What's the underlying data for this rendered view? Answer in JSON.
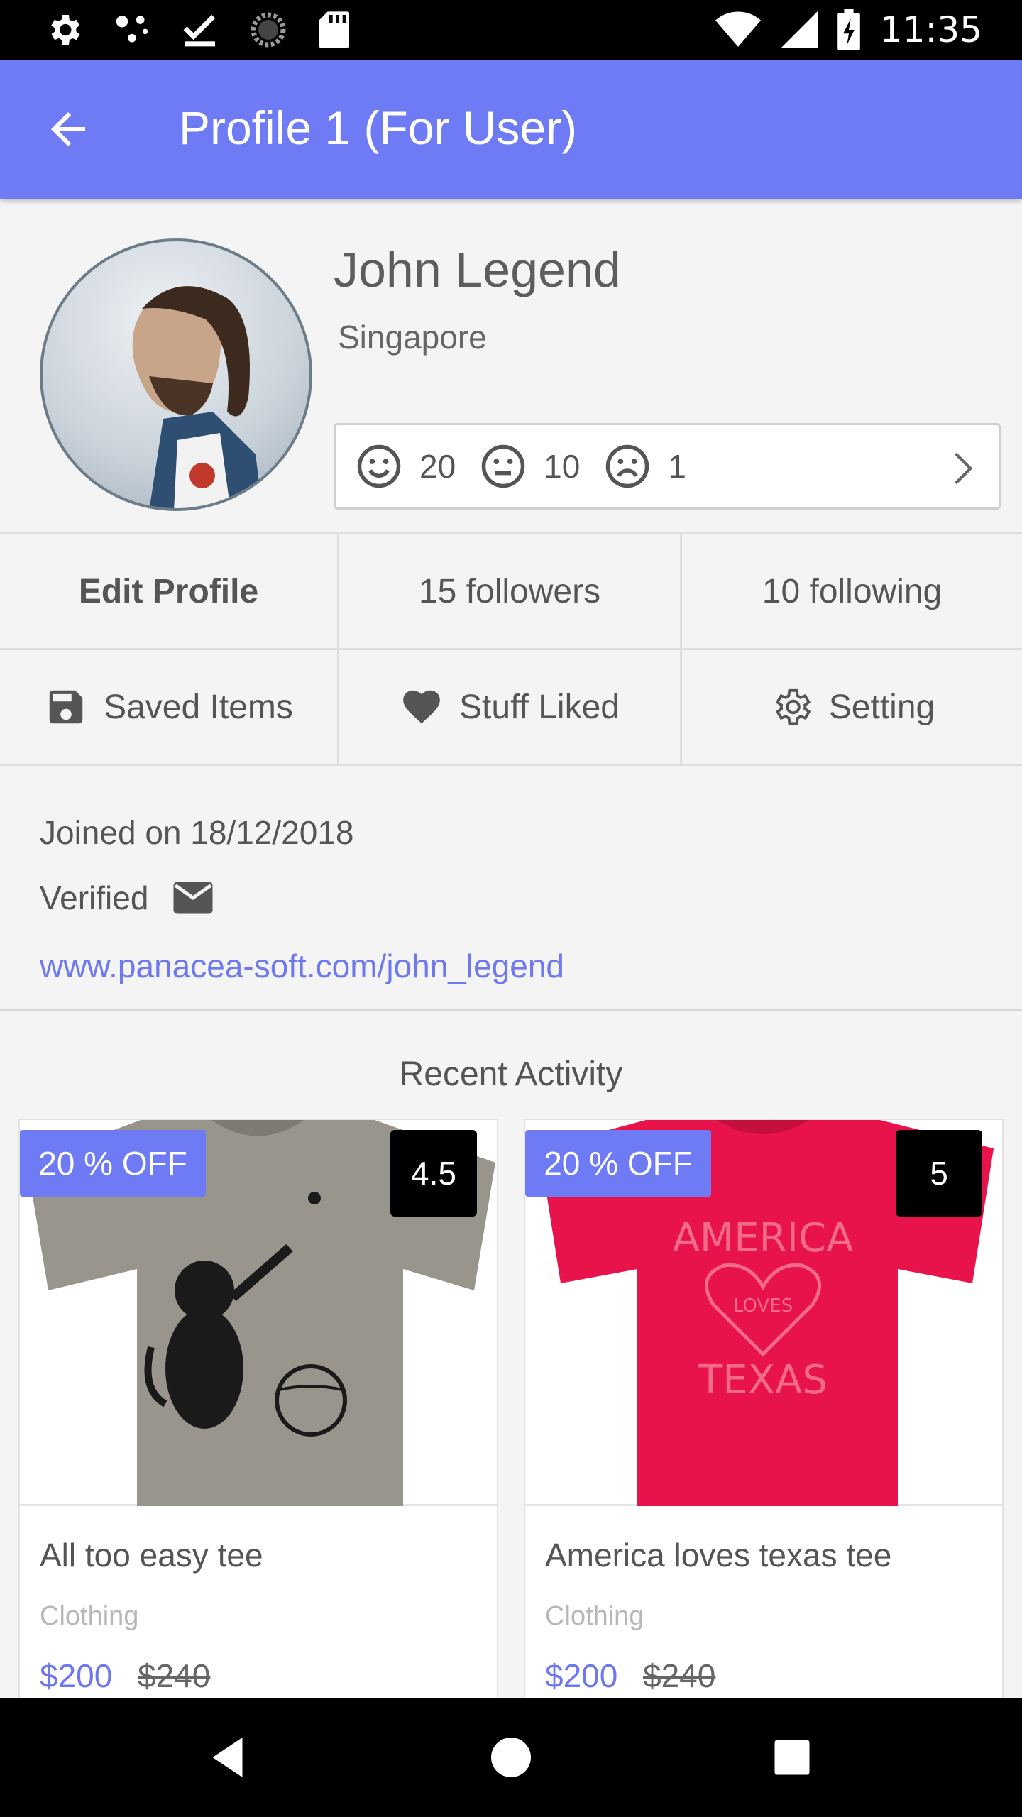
{
  "status_bar": {
    "time": "11:35",
    "left_icons": [
      "settings-icon",
      "cast-icon",
      "checkmark-icon",
      "sync-icon",
      "sd-card-icon"
    ],
    "right_icons": [
      "wifi-icon",
      "signal-icon",
      "battery-charging-icon"
    ]
  },
  "app_bar": {
    "title": "Profile 1 (For User)",
    "back_icon": "arrow-back-icon",
    "color": "#6f7bf5"
  },
  "profile": {
    "name": "John Legend",
    "location": "Singapore",
    "ratings": {
      "happy": "20",
      "neutral": "10",
      "sad": "1"
    }
  },
  "actions": {
    "edit_profile": "Edit Profile",
    "followers": "15 followers",
    "following": "10 following",
    "saved_items": "Saved Items",
    "stuff_liked": "Stuff Liked",
    "setting": "Setting"
  },
  "info": {
    "joined": "Joined on 18/12/2018",
    "verified": "Verified",
    "link": "www.panacea-soft.com/john_legend"
  },
  "recent_activity": {
    "heading": "Recent Activity",
    "items": [
      {
        "badge": "20 % OFF",
        "rating": "4.5",
        "title": "All too easy tee",
        "category": "Clothing",
        "price": "$200",
        "old_price": "$240"
      },
      {
        "badge": "20 % OFF",
        "rating": "5",
        "title": "America loves texas tee",
        "category": "Clothing",
        "price": "$200",
        "old_price": "$240",
        "shirt_print": [
          "AMERICA",
          "LOVES",
          "TEXAS"
        ]
      }
    ]
  },
  "nav_bar": {
    "icons": [
      "nav-back-icon",
      "nav-home-icon",
      "nav-recents-icon"
    ]
  }
}
